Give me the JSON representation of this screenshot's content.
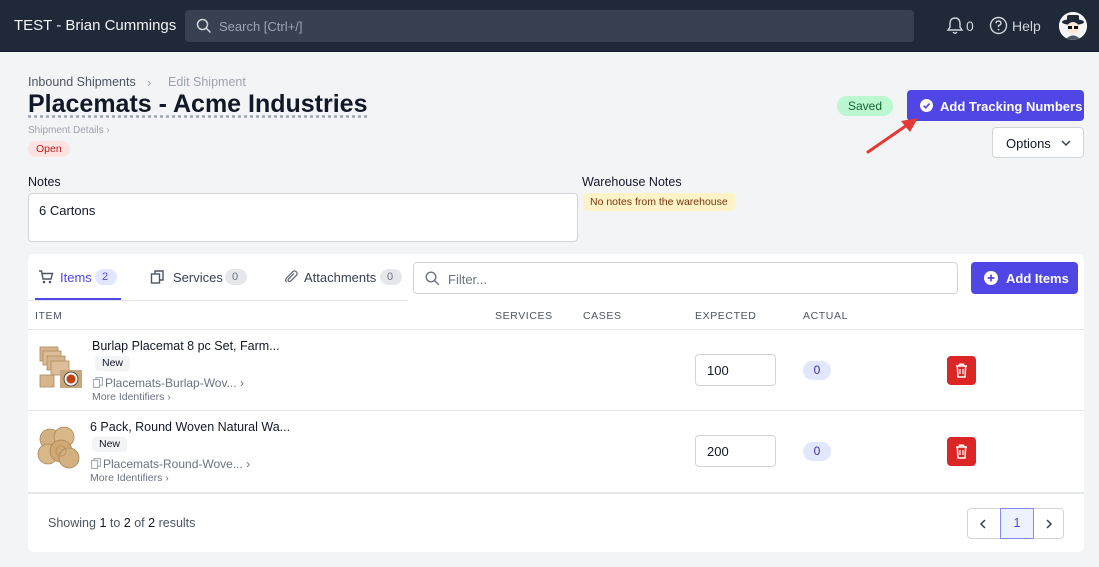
{
  "app": {
    "title": "TEST - Brian Cummings"
  },
  "search": {
    "placeholder": "Search [Ctrl+/]"
  },
  "topbar": {
    "notification_count": "0",
    "help_label": "Help"
  },
  "breadcrumb": {
    "parent": "Inbound Shipments",
    "current": "Edit Shipment"
  },
  "page": {
    "title": "Placemats - Acme Industries",
    "details_link": "Shipment Details",
    "status": "Open",
    "saved_label": "Saved",
    "tracking_button": "Add Tracking Numbers",
    "options_button": "Options"
  },
  "notes": {
    "label": "Notes",
    "value": "6 Cartons"
  },
  "warehouse_notes": {
    "label": "Warehouse Notes",
    "value": "No notes from the warehouse"
  },
  "tabs": [
    {
      "label": "Items",
      "count": "2"
    },
    {
      "label": "Services",
      "count": "0"
    },
    {
      "label": "Attachments",
      "count": "0"
    }
  ],
  "filter": {
    "placeholder": "Filter..."
  },
  "add_items_button": "Add Items",
  "table": {
    "columns": [
      "ITEM",
      "SERVICES",
      "CASES",
      "EXPECTED",
      "ACTUAL"
    ],
    "rows": [
      {
        "name": "Burlap Placemat 8 pc Set, Farm...",
        "badge": "New",
        "sku": "Placemats-Burlap-Wov...",
        "more": "More Identifiers",
        "expected": "100",
        "actual": "0"
      },
      {
        "name": "6 Pack, Round Woven Natural Wa...",
        "badge": "New",
        "sku": "Placemats-Round-Wove...",
        "more": "More Identifiers",
        "expected": "200",
        "actual": "0"
      }
    ]
  },
  "pagination": {
    "prefix": "Showing",
    "from": "1",
    "to_word": "to",
    "to": "2",
    "of_word": "of",
    "total": "2",
    "suffix": "results",
    "current_page": "1"
  },
  "colors": {
    "primary": "#4f46e5",
    "topbar": "#1f2937",
    "danger": "#dc2626",
    "saved": "#bbf7d0",
    "open": "#fee2e2",
    "annotation_arrow": "#e53935"
  }
}
